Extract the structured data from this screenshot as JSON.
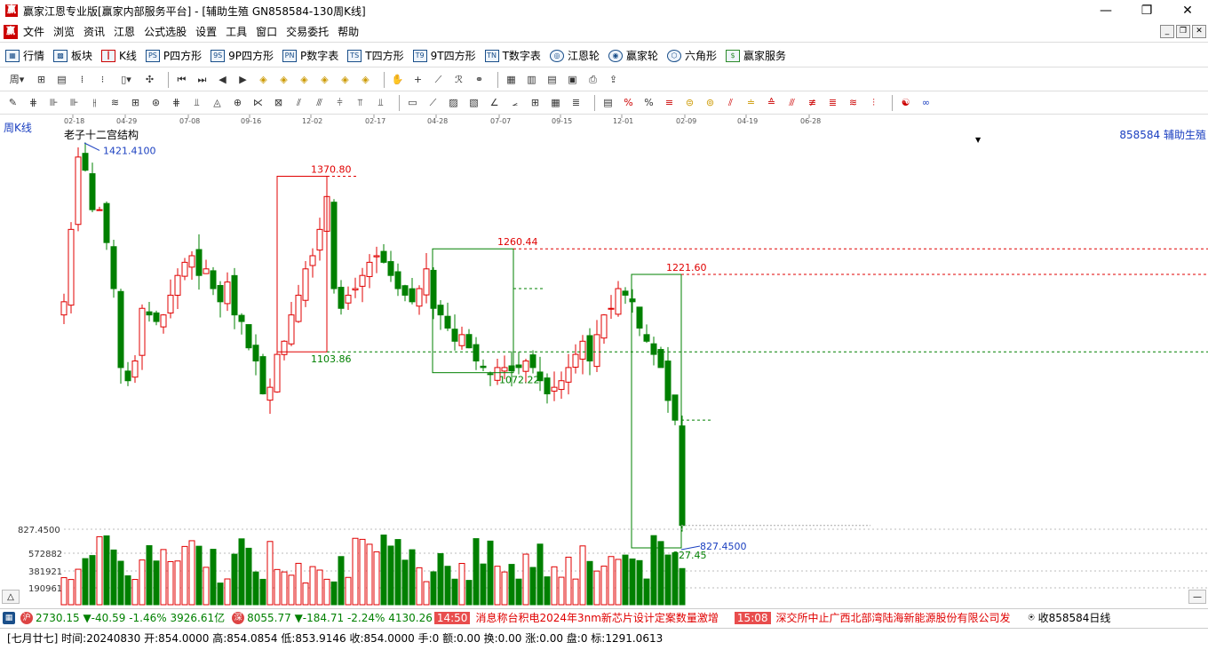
{
  "window": {
    "title": "赢家江恩专业版[赢家内部服务平台] - [辅助生殖  GN858584-130周K线]",
    "app_icon": "赢"
  },
  "menu": [
    "文件",
    "浏览",
    "资讯",
    "江恩",
    "公式选股",
    "设置",
    "工具",
    "窗口",
    "交易委托",
    "帮助"
  ],
  "toolbar1": [
    {
      "icon": "grid-icon",
      "label": "行情"
    },
    {
      "icon": "blocks-icon",
      "label": "板块"
    },
    {
      "icon": "kline-icon",
      "label": "K线"
    },
    {
      "icon": "p-square-icon",
      "label": "P四方形",
      "abbr": "PS"
    },
    {
      "icon": "9p-square-icon",
      "label": "9P四方形",
      "abbr": "9S"
    },
    {
      "icon": "p-number-icon",
      "label": "P数字表",
      "abbr": "PN"
    },
    {
      "icon": "t-square-icon",
      "label": "T四方形",
      "abbr": "TS"
    },
    {
      "icon": "9t-square-icon",
      "label": "9T四方形",
      "abbr": "T9"
    },
    {
      "icon": "t-number-icon",
      "label": "T数字表",
      "abbr": "TN"
    },
    {
      "icon": "gann-wheel-icon",
      "label": "江恩轮"
    },
    {
      "icon": "winner-wheel-icon",
      "label": "赢家轮"
    },
    {
      "icon": "hexagon-icon",
      "label": "六角形"
    },
    {
      "icon": "dollar-icon",
      "label": "赢家服务"
    }
  ],
  "chart": {
    "period_label": "周K线",
    "indicator_name": "老子十二宫结构",
    "code_label": "858584 辅助生殖",
    "date_ticks": [
      "02-18",
      "04-29",
      "07-08",
      "09-16",
      "12-02",
      "02-17",
      "04-28",
      "07-07",
      "09-15",
      "12-01",
      "02-09",
      "04-19",
      "06-28"
    ],
    "price_labels": {
      "high": "1421.4100",
      "box1_high": "1370.80",
      "box1_low": "1103.86",
      "box2_high": "1260.44",
      "box2_low": "1072.22",
      "box3_high": "1221.60",
      "low": "827.45",
      "low_precise": "827.4500"
    },
    "volume_axis": [
      "827.4500",
      "572882",
      "381921",
      "190961"
    ]
  },
  "chart_data": {
    "type": "candlestick",
    "title": "老子十二宫结构",
    "levels": [
      1370.8,
      1260.44,
      1221.6,
      1103.86,
      1072.22,
      827.45
    ],
    "high": 1421.41,
    "low": 827.45,
    "ylim": [
      800,
      1440
    ]
  },
  "status": {
    "index1": {
      "value": "2730.15",
      "change": "▼-40.59",
      "pct": "-1.46%",
      "amount": "3926.61亿"
    },
    "index2": {
      "value": "8055.77",
      "change": "▼-184.71",
      "pct": "-2.24%",
      "amount": "4130.26"
    },
    "news": [
      {
        "time": "14:50",
        "text": "消息称台积电2024年3nm新芯片设计定案数量激增"
      },
      {
        "time": "15:08",
        "text": "深交所中止广西北部湾陆海新能源股份有限公司发"
      }
    ],
    "right": "收858584日线"
  },
  "info": "[七月廿七] 时间:20240830 开:854.0000 高:854.0854 低:853.9146 收:854.0000 手:0 额:0.00 换:0.00 涨:0.00 盘:0 标:1291.0613"
}
